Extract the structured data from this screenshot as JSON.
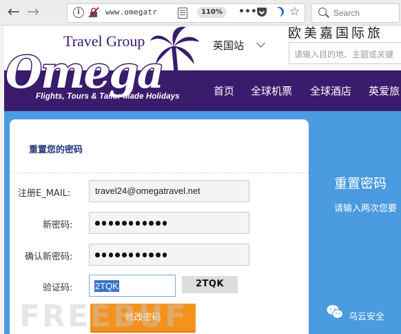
{
  "browser": {
    "url": "www.omegatr",
    "zoom": "110%",
    "search_placeholder": "Search",
    "menu_dots": "•••"
  },
  "site": {
    "logo_text": "Omega",
    "logo_group": "Travel Group",
    "logo_tagline": "Flights, Tours & Tailor Made Holidays",
    "region": "英国站",
    "banner_text": "欧美嘉国际旅",
    "search_placeholder": "请输入目的地、主题或关键",
    "nav": [
      "首页",
      "全球机票",
      "全球酒店",
      "英爱旅"
    ]
  },
  "form": {
    "title": "重置您的密码",
    "email_label": "注册E_MAIL:",
    "email_value": "travel24@omegatravel.net",
    "new_password_label": "新密码:",
    "confirm_password_label": "确认新密码:",
    "captcha_label": "验证码:",
    "captcha_input": "2TQK",
    "captcha_image_text": "2TQK",
    "submit_label": "修改密码"
  },
  "side_panel": {
    "title": "重置密码",
    "subtitle": "请输入两次您要"
  },
  "watermark": {
    "account": "乌云安全",
    "brand": "FREEBUF"
  }
}
